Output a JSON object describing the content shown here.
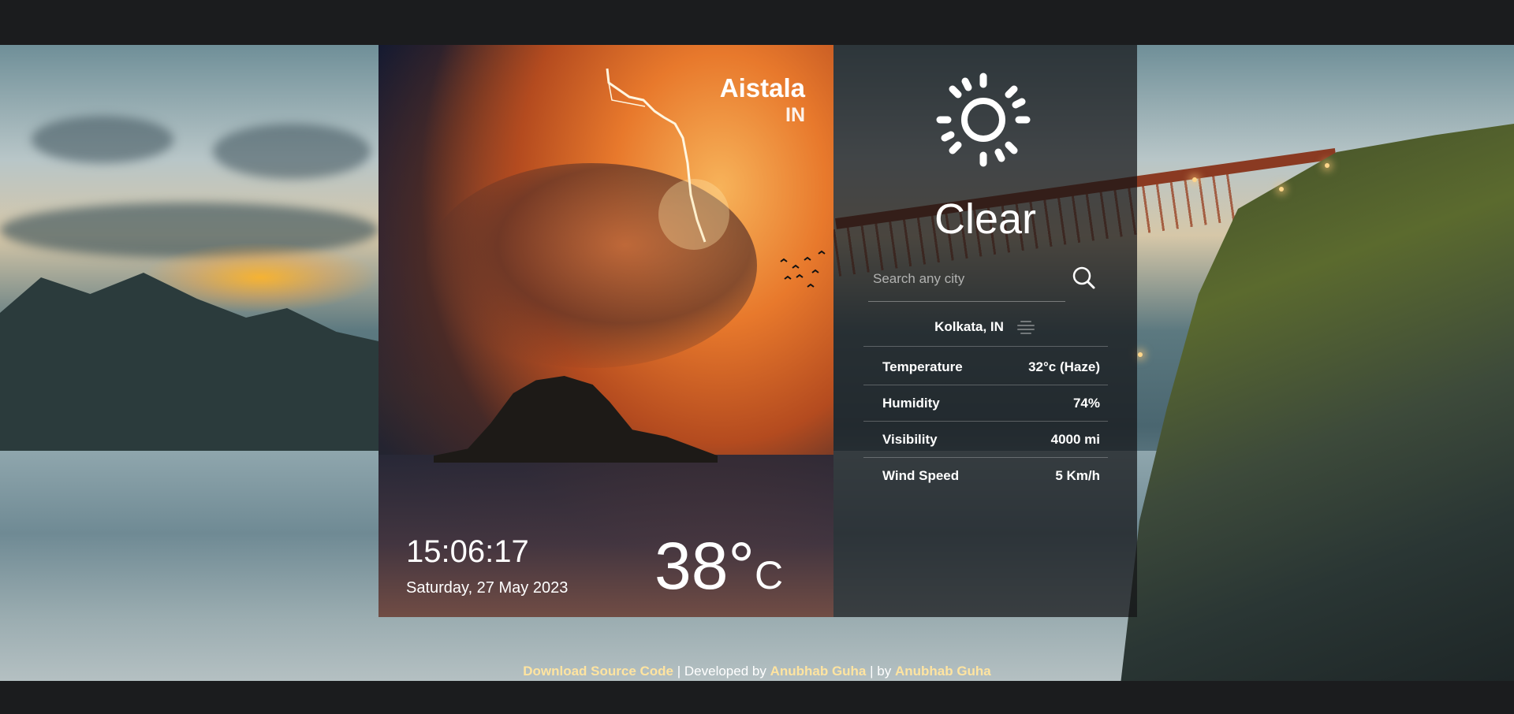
{
  "location": {
    "city": "Aistala",
    "country": "IN"
  },
  "clock": {
    "time": "15:06:17",
    "date": "Saturday, 27 May 2023"
  },
  "temperature": {
    "value": "38°",
    "unit": "C"
  },
  "weather": {
    "condition": "Clear",
    "icon": "sun-icon"
  },
  "search": {
    "placeholder": "Search any city",
    "value": ""
  },
  "result": {
    "label": "Kolkata, IN",
    "icon": "haze-icon"
  },
  "stats": [
    {
      "label": "Temperature",
      "value": "32°c (Haze)"
    },
    {
      "label": "Humidity",
      "value": "74%"
    },
    {
      "label": "Visibility",
      "value": "4000 mi"
    },
    {
      "label": "Wind Speed",
      "value": "5 Km/h"
    }
  ],
  "footer": {
    "download_link": "Download Source Code",
    "separator1": " | Developed by ",
    "developer_link": "Anubhab Guha",
    "separator2": " | by ",
    "author_link": "Anubhab Guha"
  },
  "colors": {
    "page_background": "#1b1c1e",
    "footer_link": "#ffe4a0",
    "text": "#ffffff"
  }
}
